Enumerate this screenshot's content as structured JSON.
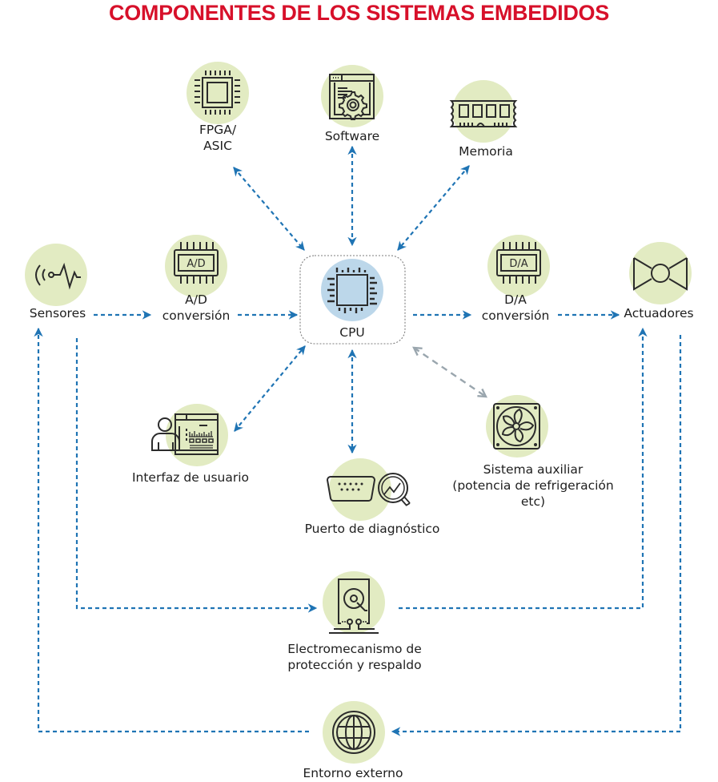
{
  "title": "COMPONENTES DE LOS SISTEMAS EMBEDIDOS",
  "colors": {
    "title": "#d7102a",
    "node_fill": "#e2ebc2",
    "cpu_fill": "#bcd7ea",
    "arrow": "#1f74b4",
    "aux_arrow": "#9aa6ae",
    "icon_stroke": "#2b2b2b"
  },
  "nodes": {
    "fpga": {
      "line1": "FPGA/",
      "line2": "ASIC",
      "icon": "chip-icon"
    },
    "software": {
      "label": "Software",
      "icon": "software-gear-icon"
    },
    "memoria": {
      "label": "Memoria",
      "icon": "memory-module-icon"
    },
    "sensores": {
      "label": "Sensores",
      "icon": "sensor-wave-icon"
    },
    "ad": {
      "chip_text": "A/D",
      "line1": "A/D",
      "line2": "conversión",
      "icon": "ad-converter-icon"
    },
    "cpu": {
      "label": "CPU",
      "icon": "cpu-icon"
    },
    "da": {
      "chip_text": "D/A",
      "line1": "D/A",
      "line2": "conversión",
      "icon": "da-converter-icon"
    },
    "actuadores": {
      "label": "Actuadores",
      "icon": "valve-icon"
    },
    "interfaz": {
      "label": "Interfaz de usuario",
      "icon": "user-interface-icon"
    },
    "puerto": {
      "label": "Puerto de diagnóstico",
      "icon": "diagnostic-port-icon"
    },
    "auxiliar": {
      "line1": "Sistema auxiliar",
      "line2": "(potencia de refrigeración",
      "line3": "etc)",
      "icon": "fan-icon"
    },
    "electro": {
      "line1": "Electromecanismo de",
      "line2": "protección y respaldo",
      "icon": "hard-drive-icon"
    },
    "entorno": {
      "label": "Entorno externo",
      "icon": "globe-icon"
    }
  },
  "connections": [
    {
      "from": "fpga",
      "to": "cpu",
      "type": "bidirectional"
    },
    {
      "from": "software",
      "to": "cpu",
      "type": "bidirectional"
    },
    {
      "from": "memoria",
      "to": "cpu",
      "type": "bidirectional"
    },
    {
      "from": "sensores",
      "to": "ad",
      "type": "directed"
    },
    {
      "from": "ad",
      "to": "cpu",
      "type": "directed"
    },
    {
      "from": "cpu",
      "to": "da",
      "type": "directed"
    },
    {
      "from": "da",
      "to": "actuadores",
      "type": "directed"
    },
    {
      "from": "interfaz",
      "to": "cpu",
      "type": "bidirectional"
    },
    {
      "from": "puerto",
      "to": "cpu",
      "type": "bidirectional"
    },
    {
      "from": "auxiliar",
      "to": "cpu",
      "type": "bidirectional-auxiliary"
    },
    {
      "from": "sensores",
      "to": "electro",
      "type": "directed"
    },
    {
      "from": "electro",
      "to": "actuadores",
      "type": "directed"
    },
    {
      "from": "actuadores",
      "to": "entorno",
      "type": "directed"
    },
    {
      "from": "entorno",
      "to": "sensores",
      "type": "directed"
    }
  ]
}
